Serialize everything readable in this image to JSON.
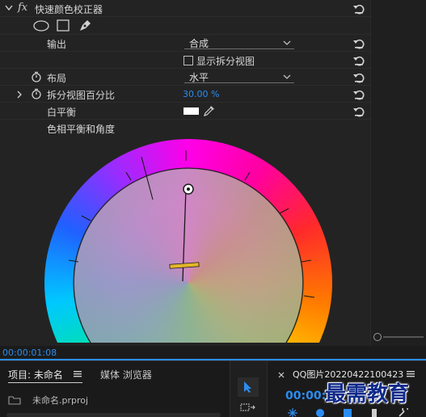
{
  "effect": {
    "name": "快速颜色校正器",
    "fx_label": "fx"
  },
  "rows": {
    "output_label": "输出",
    "output_value": "合成",
    "split_checkbox_label": "显示拆分视图",
    "layout_label": "布局",
    "layout_value": "水平",
    "split_percent_label": "拆分视图百分比",
    "split_percent_value": "30.00 %",
    "white_balance_label": "白平衡",
    "hue_angle_label": "色相平衡和角度"
  },
  "timecode": "00:00:01:08",
  "bottom": {
    "project_tab": "项目: 未命名",
    "media_tab": "媒体 浏览器",
    "project_file": "未命名.prproj",
    "clip_tab": "QQ图片20220422100423",
    "clip_timecode": "00:00:",
    "watermark": "最需教育"
  },
  "colors": {
    "accent": "#2b8df0",
    "needle_handle": "#e2b52a"
  }
}
